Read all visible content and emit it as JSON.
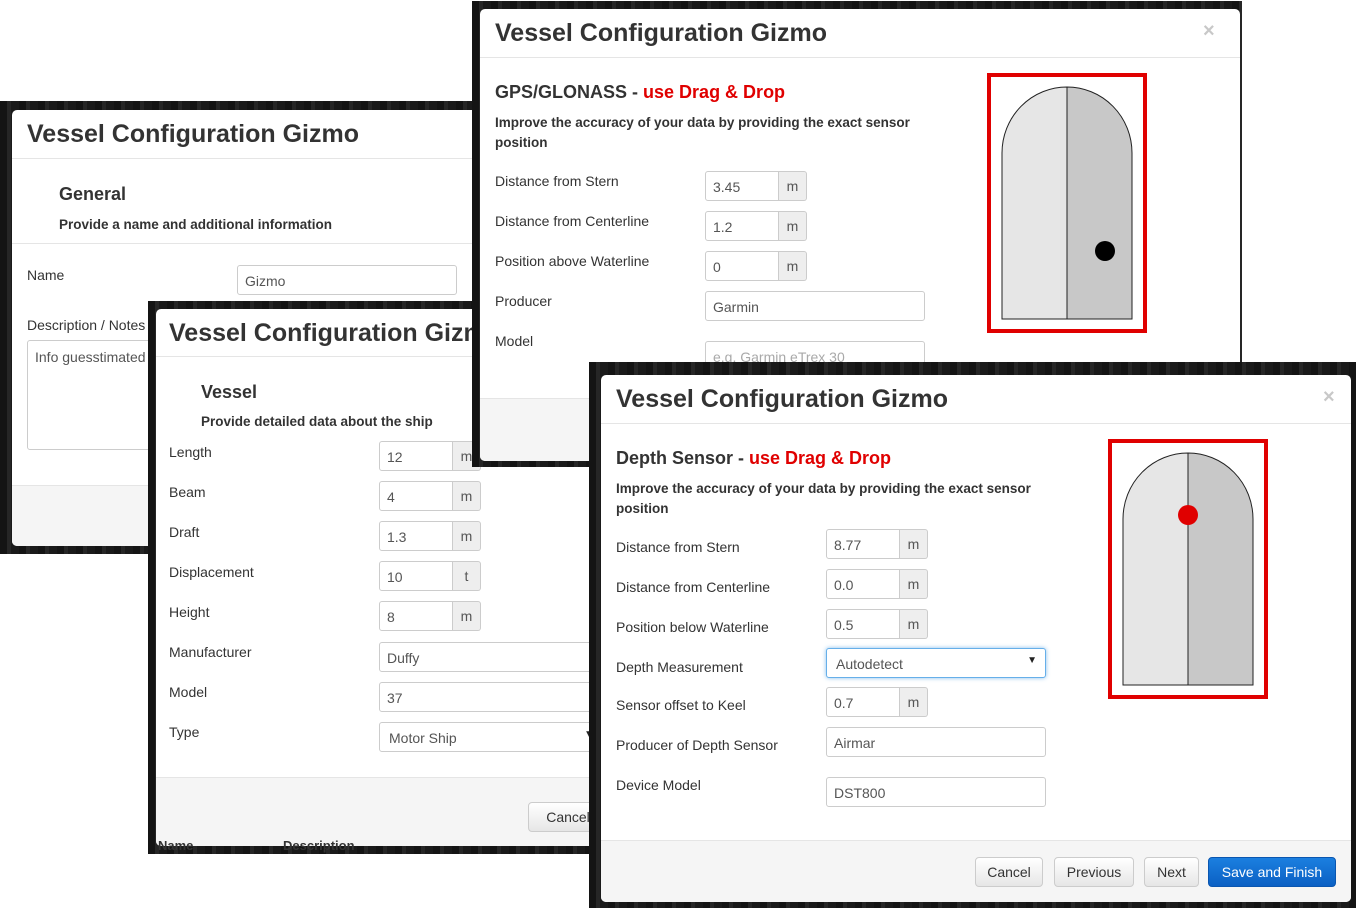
{
  "modal_title": "Vessel Configuration Gizmo",
  "close_glyph": "×",
  "general": {
    "heading": "General",
    "subheading": "Provide a name and additional information",
    "name_label": "Name",
    "name_value": "Gizmo",
    "notes_label": "Description / Notes",
    "notes_value": "Info guesstimated"
  },
  "vessel": {
    "heading": "Vessel",
    "subheading": "Provide detailed data about the ship",
    "fields": [
      {
        "label": "Length",
        "value": "12",
        "unit": "m"
      },
      {
        "label": "Beam",
        "value": "4",
        "unit": "m"
      },
      {
        "label": "Draft",
        "value": "1.3",
        "unit": "m"
      },
      {
        "label": "Displacement",
        "value": "10",
        "unit": "t"
      },
      {
        "label": "Height",
        "value": "8",
        "unit": "m"
      },
      {
        "label": "Manufacturer",
        "value": "Duffy"
      },
      {
        "label": "Model",
        "value": "37"
      },
      {
        "label": "Type",
        "value": "Motor Ship"
      }
    ],
    "cancel_label": "Cancel"
  },
  "gps": {
    "heading": "GPS/GLONASS - ",
    "dragdrop": "use Drag & Drop",
    "subheading": "Improve the accuracy of your data by providing the exact sensor position",
    "fields": [
      {
        "label": "Distance from Stern",
        "value": "3.45",
        "unit": "m"
      },
      {
        "label": "Distance from Centerline",
        "value": "1.2",
        "unit": "m"
      },
      {
        "label": "Position above Waterline",
        "value": "0",
        "unit": "m"
      },
      {
        "label": "Producer",
        "value": "Garmin"
      },
      {
        "label": "Model",
        "placeholder": "e.g. Garmin eTrex 30"
      }
    ],
    "marker_color": "#000000"
  },
  "depth": {
    "heading": "Depth Sensor - ",
    "dragdrop": "use Drag & Drop",
    "subheading": "Improve the accuracy of your data by providing the exact sensor position",
    "fields": [
      {
        "label": "Distance from Stern",
        "value": "8.77",
        "unit": "m"
      },
      {
        "label": "Distance from Centerline",
        "value": "0.0",
        "unit": "m"
      },
      {
        "label": "Position below Waterline",
        "value": "0.5",
        "unit": "m"
      },
      {
        "label": "Depth Measurement",
        "value": "Autodetect"
      },
      {
        "label": "Sensor offset to Keel",
        "value": "0.7",
        "unit": "m"
      },
      {
        "label": "Producer of Depth Sensor",
        "value": "Airmar"
      },
      {
        "label": "Device Model",
        "value": "DST800"
      }
    ],
    "marker_color": "#e00000",
    "buttons": {
      "cancel": "Cancel",
      "previous": "Previous",
      "next": "Next",
      "save": "Save and Finish"
    }
  },
  "background_text": {
    "col1": "Name",
    "col2": "Description"
  },
  "colors": {
    "accent_red": "#e00000",
    "primary_blue": "#0b60c4",
    "hull_left": "#e6e6e6",
    "hull_right": "#c8c8c8"
  }
}
